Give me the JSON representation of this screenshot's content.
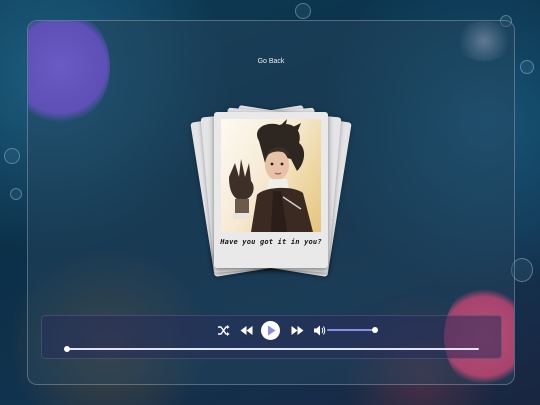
{
  "nav": {
    "go_back_label": "Go Back"
  },
  "album": {
    "caption": "Have you got it in you?",
    "cards_in_stack": 5
  },
  "player": {
    "controls": [
      "shuffle-icon",
      "rewind-icon",
      "play-icon",
      "fast-forward-icon",
      "volume-icon"
    ],
    "volume_fraction": 1.0,
    "progress_fraction": 0.0
  },
  "colors": {
    "accent": "#8a8fe6",
    "play_icon": "#8a8fe6",
    "panel": "#28465f",
    "orb_purple": "#6e5ac8",
    "orb_pink": "#c85078"
  }
}
